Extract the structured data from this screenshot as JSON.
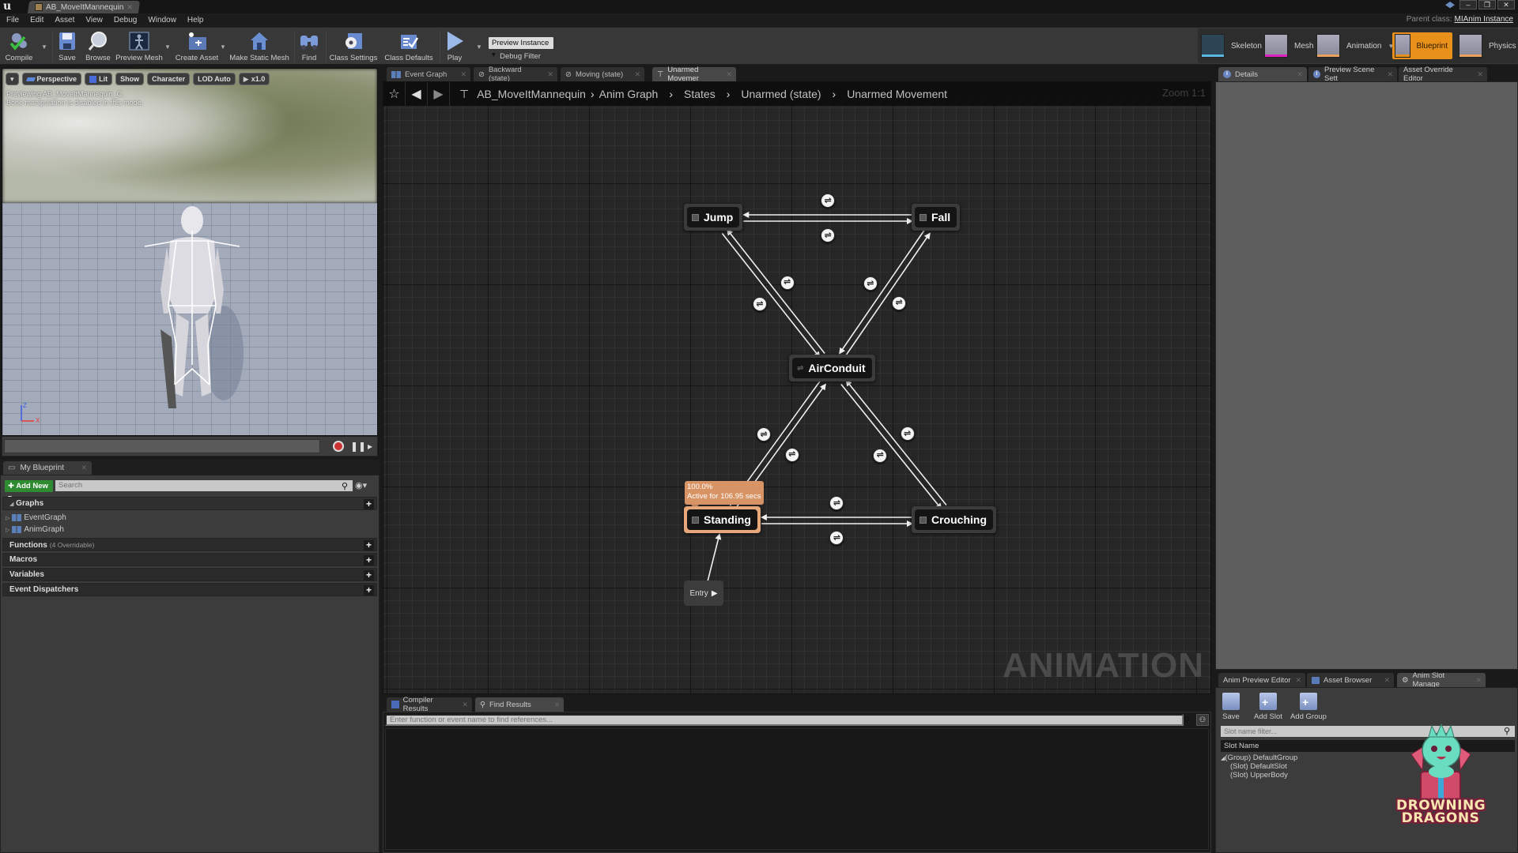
{
  "app": {
    "document_tab": "AB_MoveItMannequin",
    "parent_class_label": "Parent class:",
    "parent_class_value": "MIAnim Instance",
    "window_buttons": [
      "minimize",
      "restore",
      "close"
    ]
  },
  "menu": [
    "File",
    "Edit",
    "Asset",
    "View",
    "Debug",
    "Window",
    "Help"
  ],
  "toolbar": {
    "compile": "Compile",
    "save": "Save",
    "browse": "Browse",
    "preview_mesh": "Preview Mesh",
    "create_asset": "Create Asset",
    "make_static_mesh": "Make Static Mesh",
    "find": "Find",
    "class_settings": "Class Settings",
    "class_defaults": "Class Defaults",
    "play": "Play",
    "debug_filter_value": "Preview Instance",
    "debug_filter_label": "Debug Filter"
  },
  "modes": [
    {
      "label": "Skeleton",
      "bar": "#5ab8e0",
      "active": false
    },
    {
      "label": "Mesh",
      "bar": "#e020c0",
      "active": false
    },
    {
      "label": "Animation",
      "bar": "#e8a060",
      "active": false
    },
    {
      "label": "Blueprint",
      "bar": "#e8901a",
      "active": true
    },
    {
      "label": "Physics",
      "bar": "#e8a060",
      "active": false
    }
  ],
  "viewport": {
    "buttons": [
      "Perspective",
      "Lit",
      "Show",
      "Character",
      "LOD Auto",
      "x1.0"
    ],
    "info_line1": "Previewing AB_MoveItMannequin_C.",
    "info_line2": "Bone manipulation is disabled in this mode.",
    "axis_z": "Z",
    "axis_x": "X"
  },
  "my_blueprint": {
    "tab": "My Blueprint",
    "add_new": "Add New",
    "search_placeholder": "Search",
    "graphs_label": "Graphs",
    "graphs": [
      "EventGraph",
      "AnimGraph"
    ],
    "functions_label": "Functions",
    "functions_sub": "(4 Overridable)",
    "macros_label": "Macros",
    "variables_label": "Variables",
    "dispatchers_label": "Event Dispatchers"
  },
  "graph_tabs": [
    {
      "label": "Event Graph",
      "active": false
    },
    {
      "label": "Backward (state)",
      "active": false
    },
    {
      "label": "Moving (state)",
      "active": false
    },
    {
      "label": "Unarmed Movemer",
      "active": true
    }
  ],
  "breadcrumb": [
    "AB_MoveItMannequin",
    "Anim Graph",
    "States",
    "Unarmed (state)",
    "Unarmed Movement"
  ],
  "graph": {
    "zoom": "Zoom 1:1",
    "watermark": "ANIMATION",
    "entry_label": "Entry",
    "active_state": {
      "weight": "100.0%",
      "active_text": "Active for 106.95 secs"
    },
    "states": [
      {
        "id": "jump",
        "label": "Jump",
        "active": false
      },
      {
        "id": "fall",
        "label": "Fall",
        "active": false
      },
      {
        "id": "airconduit",
        "label": "AirConduit",
        "active": false,
        "conduit": true
      },
      {
        "id": "standing",
        "label": "Standing",
        "active": true
      },
      {
        "id": "crouching",
        "label": "Crouching",
        "active": false
      }
    ],
    "transitions": [
      {
        "from": "jump",
        "to": "fall"
      },
      {
        "from": "fall",
        "to": "jump"
      },
      {
        "from": "jump",
        "to": "airconduit"
      },
      {
        "from": "airconduit",
        "to": "jump"
      },
      {
        "from": "fall",
        "to": "airconduit"
      },
      {
        "from": "airconduit",
        "to": "fall"
      },
      {
        "from": "standing",
        "to": "airconduit"
      },
      {
        "from": "airconduit",
        "to": "standing"
      },
      {
        "from": "crouching",
        "to": "airconduit"
      },
      {
        "from": "airconduit",
        "to": "crouching"
      },
      {
        "from": "standing",
        "to": "crouching"
      },
      {
        "from": "crouching",
        "to": "standing"
      },
      {
        "from": "entry",
        "to": "standing"
      }
    ]
  },
  "bottom": {
    "tabs": [
      {
        "label": "Compiler Results",
        "active": false
      },
      {
        "label": "Find Results",
        "active": true
      }
    ],
    "find_placeholder": "Enter function or event name to find references..."
  },
  "details": {
    "tabs": [
      {
        "label": "Details",
        "active": true
      },
      {
        "label": "Preview Scene Sett",
        "active": false
      },
      {
        "label": "Asset Override Editor",
        "active": false
      }
    ]
  },
  "slot_manager": {
    "tabs": [
      {
        "label": "Anim Preview Editor",
        "active": false
      },
      {
        "label": "Asset Browser",
        "active": false
      },
      {
        "label": "Anim Slot Manage",
        "active": true
      }
    ],
    "save": "Save",
    "add_slot": "Add Slot",
    "add_group": "Add Group",
    "filter_placeholder": "Slot name filter...",
    "column": "Slot Name",
    "rows": [
      "(Group) DefaultGroup",
      "(Slot) DefaultSlot",
      "(Slot) UpperBody"
    ]
  },
  "logo": {
    "line1": "DROWNING",
    "line2": "DRAGONS"
  }
}
